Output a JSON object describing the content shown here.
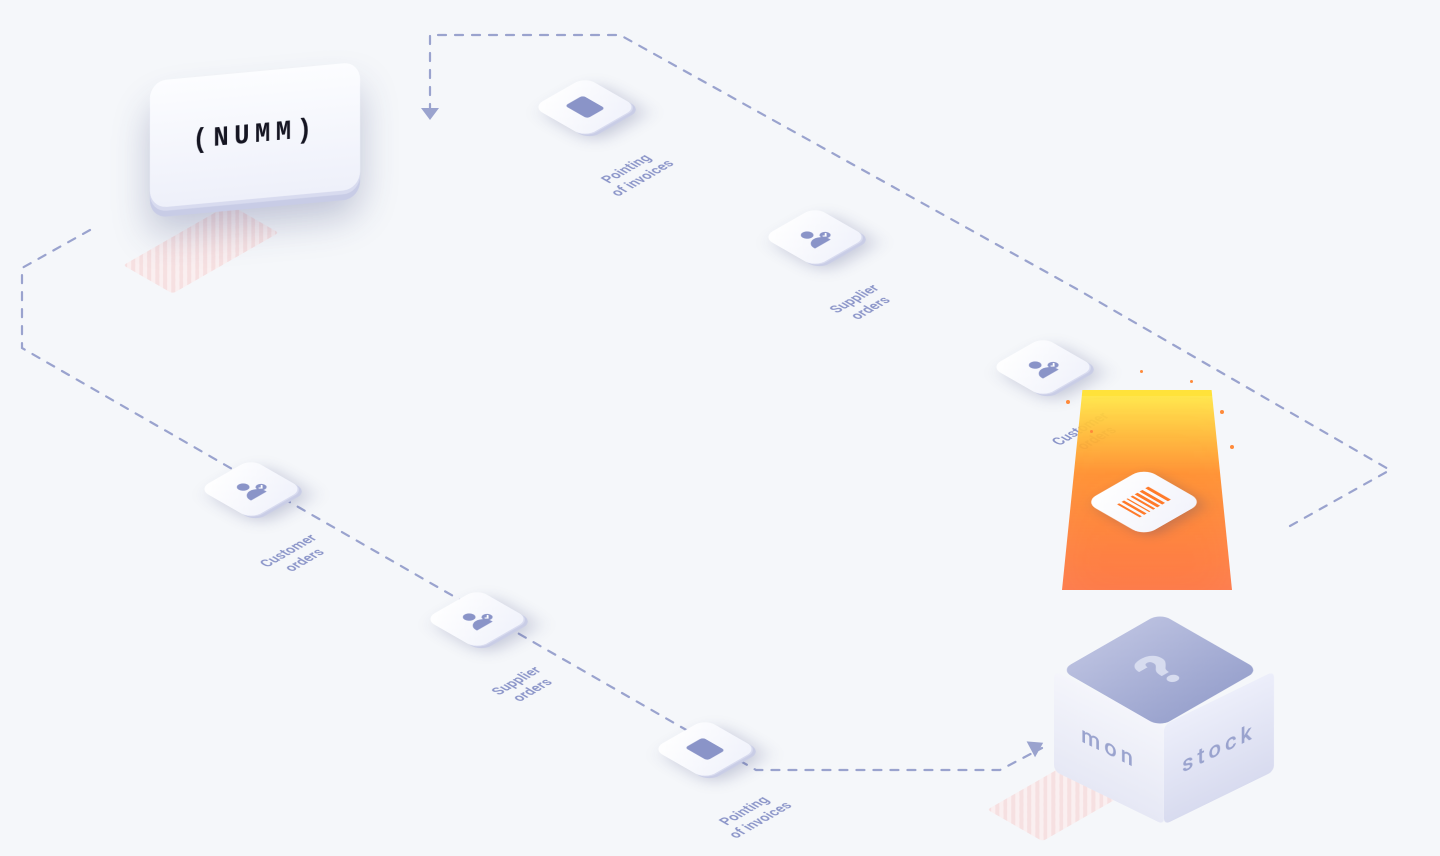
{
  "endpoints": {
    "numm": {
      "label": "(NUMM)"
    },
    "monstock": {
      "left_face": "mon",
      "right_face": "stock",
      "top_glyph": "?"
    }
  },
  "flow_top": [
    {
      "id": "pointing_invoices",
      "line1": "Pointing",
      "line2": "of invoices",
      "icon": "calculator"
    },
    {
      "id": "supplier_orders",
      "line1": "Supplier",
      "line2": "orders",
      "icon": "person-check"
    },
    {
      "id": "customer_orders",
      "line1": "Customer",
      "line2": "orders",
      "icon": "person-check"
    }
  ],
  "flow_bottom": [
    {
      "id": "customer_orders",
      "line1": "Customer",
      "line2": "orders",
      "icon": "person-check"
    },
    {
      "id": "supplier_orders",
      "line1": "Supplier",
      "line2": "orders",
      "icon": "person-check"
    },
    {
      "id": "pointing_invoices",
      "line1": "Pointing",
      "line2": "of invoices",
      "icon": "calculator"
    }
  ]
}
